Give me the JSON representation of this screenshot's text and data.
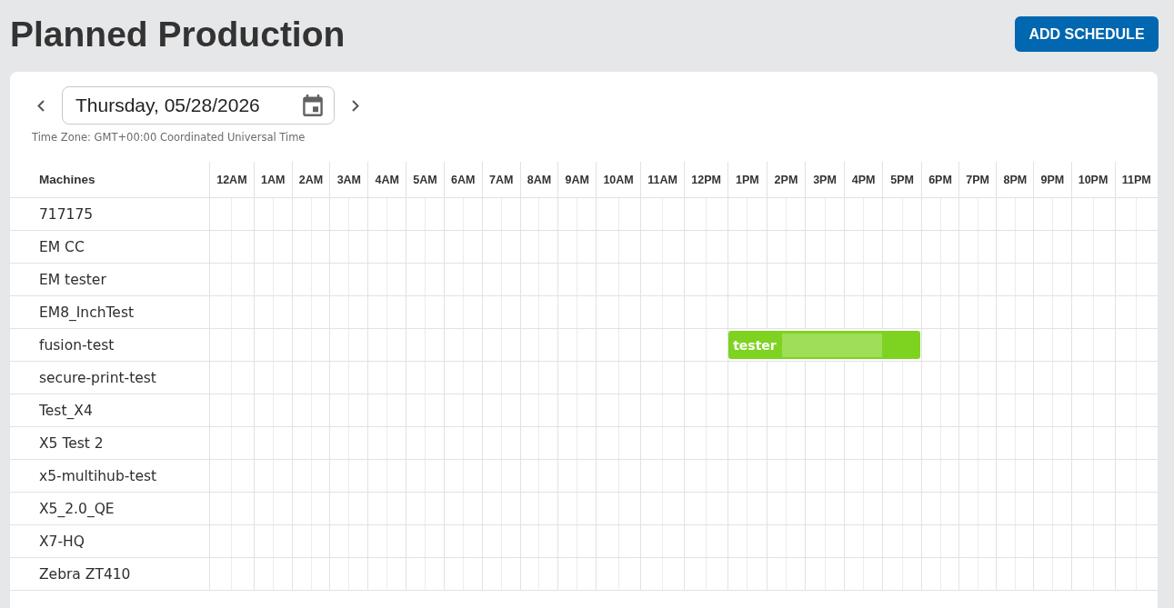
{
  "page": {
    "title": "Planned Production",
    "add_button": "ADD SCHEDULE"
  },
  "date_picker": {
    "value": "Thursday, 05/28/2026",
    "timezone": "Time Zone: GMT+00:00 Coordinated Universal Time"
  },
  "schedule": {
    "columns": {
      "machines": "Machines",
      "hours": [
        "12AM",
        "1AM",
        "2AM",
        "3AM",
        "4AM",
        "5AM",
        "6AM",
        "7AM",
        "8AM",
        "9AM",
        "10AM",
        "11AM",
        "12PM",
        "1PM",
        "2PM",
        "3PM",
        "4PM",
        "5PM",
        "6PM",
        "7PM",
        "8PM",
        "9PM",
        "10PM",
        "11PM"
      ]
    },
    "rows": [
      {
        "machine": "717175"
      },
      {
        "machine": "EM CC"
      },
      {
        "machine": "EM tester"
      },
      {
        "machine": "EM8_InchTest"
      },
      {
        "machine": "fusion-test",
        "slots": [
          {
            "booked": false
          },
          {
            "booked": false
          },
          {
            "booked": false
          },
          {
            "booked": false
          },
          {
            "booked": false
          },
          {
            "booked": false
          },
          {
            "booked": false
          },
          {
            "booked": false
          },
          {
            "booked": false
          },
          {
            "booked": false
          },
          {
            "booked": false
          },
          {
            "booked": false
          },
          {
            "booked": false
          },
          {
            "booked": true,
            "event": {
              "title": "tester",
              "redacted": true
            }
          },
          {
            "booked": true
          },
          {
            "booked": true
          },
          {
            "booked": true
          },
          {
            "booked": true
          },
          {
            "booked": false
          },
          {
            "booked": false
          },
          {
            "booked": false
          },
          {
            "booked": false
          },
          {
            "booked": false
          },
          {
            "booked": false
          }
        ]
      },
      {
        "machine": "secure-print-test"
      },
      {
        "machine": "Test_X4"
      },
      {
        "machine": "X5 Test 2"
      },
      {
        "machine": "x5-multihub-test"
      },
      {
        "machine": "X5_2.0_QE"
      },
      {
        "machine": "X7-HQ"
      },
      {
        "machine": "Zebra ZT410"
      }
    ]
  }
}
